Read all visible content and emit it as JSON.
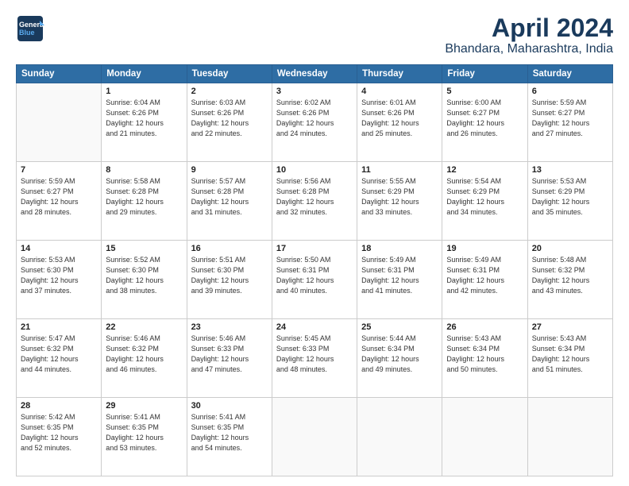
{
  "header": {
    "logo_line1": "General",
    "logo_line2": "Blue",
    "title": "April 2024",
    "subtitle": "Bhandara, Maharashtra, India"
  },
  "weekdays": [
    "Sunday",
    "Monday",
    "Tuesday",
    "Wednesday",
    "Thursday",
    "Friday",
    "Saturday"
  ],
  "weeks": [
    [
      {
        "num": "",
        "info": ""
      },
      {
        "num": "1",
        "info": "Sunrise: 6:04 AM\nSunset: 6:26 PM\nDaylight: 12 hours\nand 21 minutes."
      },
      {
        "num": "2",
        "info": "Sunrise: 6:03 AM\nSunset: 6:26 PM\nDaylight: 12 hours\nand 22 minutes."
      },
      {
        "num": "3",
        "info": "Sunrise: 6:02 AM\nSunset: 6:26 PM\nDaylight: 12 hours\nand 24 minutes."
      },
      {
        "num": "4",
        "info": "Sunrise: 6:01 AM\nSunset: 6:26 PM\nDaylight: 12 hours\nand 25 minutes."
      },
      {
        "num": "5",
        "info": "Sunrise: 6:00 AM\nSunset: 6:27 PM\nDaylight: 12 hours\nand 26 minutes."
      },
      {
        "num": "6",
        "info": "Sunrise: 5:59 AM\nSunset: 6:27 PM\nDaylight: 12 hours\nand 27 minutes."
      }
    ],
    [
      {
        "num": "7",
        "info": "Sunrise: 5:59 AM\nSunset: 6:27 PM\nDaylight: 12 hours\nand 28 minutes."
      },
      {
        "num": "8",
        "info": "Sunrise: 5:58 AM\nSunset: 6:28 PM\nDaylight: 12 hours\nand 29 minutes."
      },
      {
        "num": "9",
        "info": "Sunrise: 5:57 AM\nSunset: 6:28 PM\nDaylight: 12 hours\nand 31 minutes."
      },
      {
        "num": "10",
        "info": "Sunrise: 5:56 AM\nSunset: 6:28 PM\nDaylight: 12 hours\nand 32 minutes."
      },
      {
        "num": "11",
        "info": "Sunrise: 5:55 AM\nSunset: 6:29 PM\nDaylight: 12 hours\nand 33 minutes."
      },
      {
        "num": "12",
        "info": "Sunrise: 5:54 AM\nSunset: 6:29 PM\nDaylight: 12 hours\nand 34 minutes."
      },
      {
        "num": "13",
        "info": "Sunrise: 5:53 AM\nSunset: 6:29 PM\nDaylight: 12 hours\nand 35 minutes."
      }
    ],
    [
      {
        "num": "14",
        "info": "Sunrise: 5:53 AM\nSunset: 6:30 PM\nDaylight: 12 hours\nand 37 minutes."
      },
      {
        "num": "15",
        "info": "Sunrise: 5:52 AM\nSunset: 6:30 PM\nDaylight: 12 hours\nand 38 minutes."
      },
      {
        "num": "16",
        "info": "Sunrise: 5:51 AM\nSunset: 6:30 PM\nDaylight: 12 hours\nand 39 minutes."
      },
      {
        "num": "17",
        "info": "Sunrise: 5:50 AM\nSunset: 6:31 PM\nDaylight: 12 hours\nand 40 minutes."
      },
      {
        "num": "18",
        "info": "Sunrise: 5:49 AM\nSunset: 6:31 PM\nDaylight: 12 hours\nand 41 minutes."
      },
      {
        "num": "19",
        "info": "Sunrise: 5:49 AM\nSunset: 6:31 PM\nDaylight: 12 hours\nand 42 minutes."
      },
      {
        "num": "20",
        "info": "Sunrise: 5:48 AM\nSunset: 6:32 PM\nDaylight: 12 hours\nand 43 minutes."
      }
    ],
    [
      {
        "num": "21",
        "info": "Sunrise: 5:47 AM\nSunset: 6:32 PM\nDaylight: 12 hours\nand 44 minutes."
      },
      {
        "num": "22",
        "info": "Sunrise: 5:46 AM\nSunset: 6:32 PM\nDaylight: 12 hours\nand 46 minutes."
      },
      {
        "num": "23",
        "info": "Sunrise: 5:46 AM\nSunset: 6:33 PM\nDaylight: 12 hours\nand 47 minutes."
      },
      {
        "num": "24",
        "info": "Sunrise: 5:45 AM\nSunset: 6:33 PM\nDaylight: 12 hours\nand 48 minutes."
      },
      {
        "num": "25",
        "info": "Sunrise: 5:44 AM\nSunset: 6:34 PM\nDaylight: 12 hours\nand 49 minutes."
      },
      {
        "num": "26",
        "info": "Sunrise: 5:43 AM\nSunset: 6:34 PM\nDaylight: 12 hours\nand 50 minutes."
      },
      {
        "num": "27",
        "info": "Sunrise: 5:43 AM\nSunset: 6:34 PM\nDaylight: 12 hours\nand 51 minutes."
      }
    ],
    [
      {
        "num": "28",
        "info": "Sunrise: 5:42 AM\nSunset: 6:35 PM\nDaylight: 12 hours\nand 52 minutes."
      },
      {
        "num": "29",
        "info": "Sunrise: 5:41 AM\nSunset: 6:35 PM\nDaylight: 12 hours\nand 53 minutes."
      },
      {
        "num": "30",
        "info": "Sunrise: 5:41 AM\nSunset: 6:35 PM\nDaylight: 12 hours\nand 54 minutes."
      },
      {
        "num": "",
        "info": ""
      },
      {
        "num": "",
        "info": ""
      },
      {
        "num": "",
        "info": ""
      },
      {
        "num": "",
        "info": ""
      }
    ]
  ]
}
